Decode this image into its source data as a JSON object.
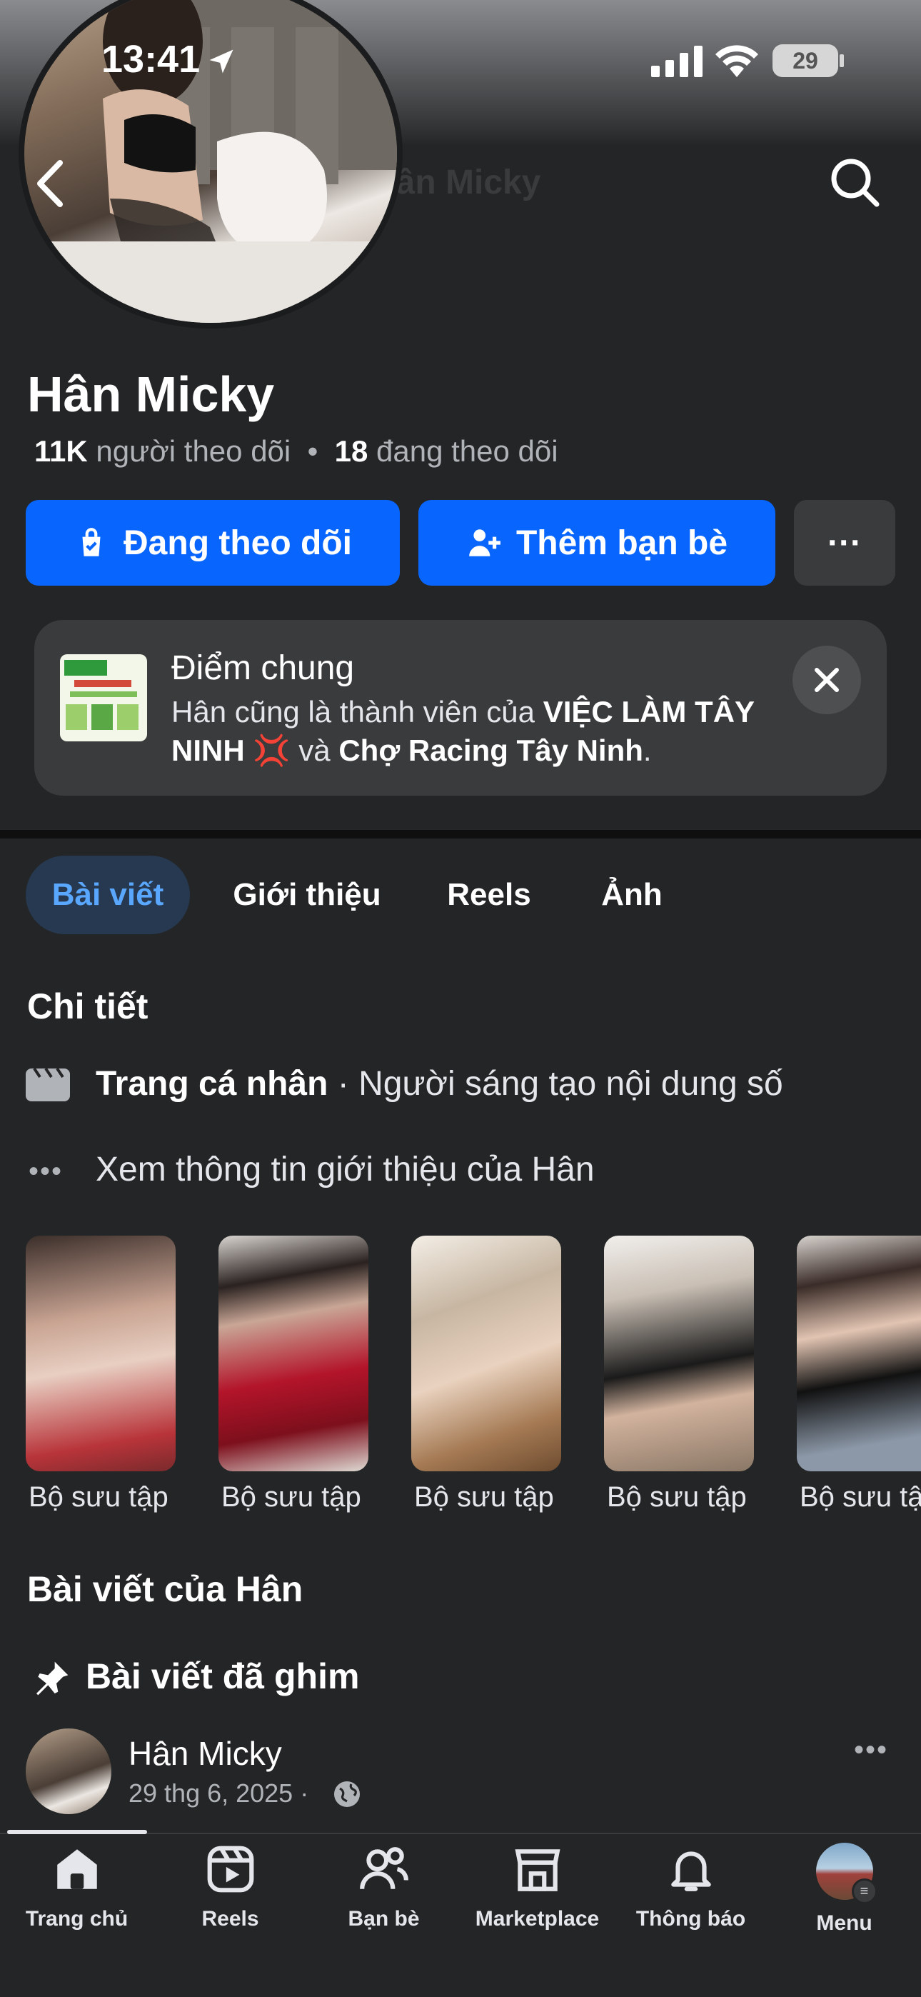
{
  "status": {
    "time": "13:41",
    "battery": "29"
  },
  "header": {
    "title": "Hân Micky"
  },
  "profile": {
    "name": "Hân Micky",
    "followers_count": "11K",
    "followers_label": "người theo dõi",
    "following_count": "18",
    "following_label": "đang theo dõi"
  },
  "actions": {
    "following": "Đang theo dõi",
    "add_friend": "Thêm bạn bè",
    "more": "···"
  },
  "mutual": {
    "title": "Điểm chung",
    "text_prefix": "Hân cũng là thành viên của ",
    "group1": "VIỆC LÀM TÂY NINH",
    "emoji": "💢",
    "connector": " và ",
    "group2": "Chợ Racing Tây Ninh",
    "suffix": "."
  },
  "tabs": [
    {
      "label": "Bài viết",
      "active": true
    },
    {
      "label": "Giới thiệu"
    },
    {
      "label": "Reels"
    },
    {
      "label": "Ảnh"
    }
  ],
  "details": {
    "title": "Chi tiết",
    "page_type_bold": "Trang cá nhân",
    "page_type_rest": " · Người sáng tạo nội dung số",
    "see_about": "Xem thông tin giới thiệu của Hân"
  },
  "collections": [
    {
      "label": "Bộ sưu tập"
    },
    {
      "label": "Bộ sưu tập"
    },
    {
      "label": "Bộ sưu tập"
    },
    {
      "label": "Bộ sưu tập"
    },
    {
      "label": "Bộ sưu tập"
    }
  ],
  "posts": {
    "section_title": "Bài viết của Hân",
    "pinned_label": "Bài viết đã ghim",
    "author": "Hân Micky",
    "date": "29 thg 6, 2025 ·"
  },
  "bottom_nav": [
    {
      "label": "Trang chủ",
      "icon": "home-icon"
    },
    {
      "label": "Reels",
      "icon": "reels-icon"
    },
    {
      "label": "Bạn bè",
      "icon": "friends-icon"
    },
    {
      "label": "Marketplace",
      "icon": "marketplace-icon"
    },
    {
      "label": "Thông báo",
      "icon": "bell-icon"
    },
    {
      "label": "Menu",
      "icon": "menu-avatar"
    }
  ],
  "colors": {
    "accent": "#0866ff",
    "background": "#242526",
    "surface": "#3a3b3c",
    "tab_active_text": "#5aa7ff"
  }
}
